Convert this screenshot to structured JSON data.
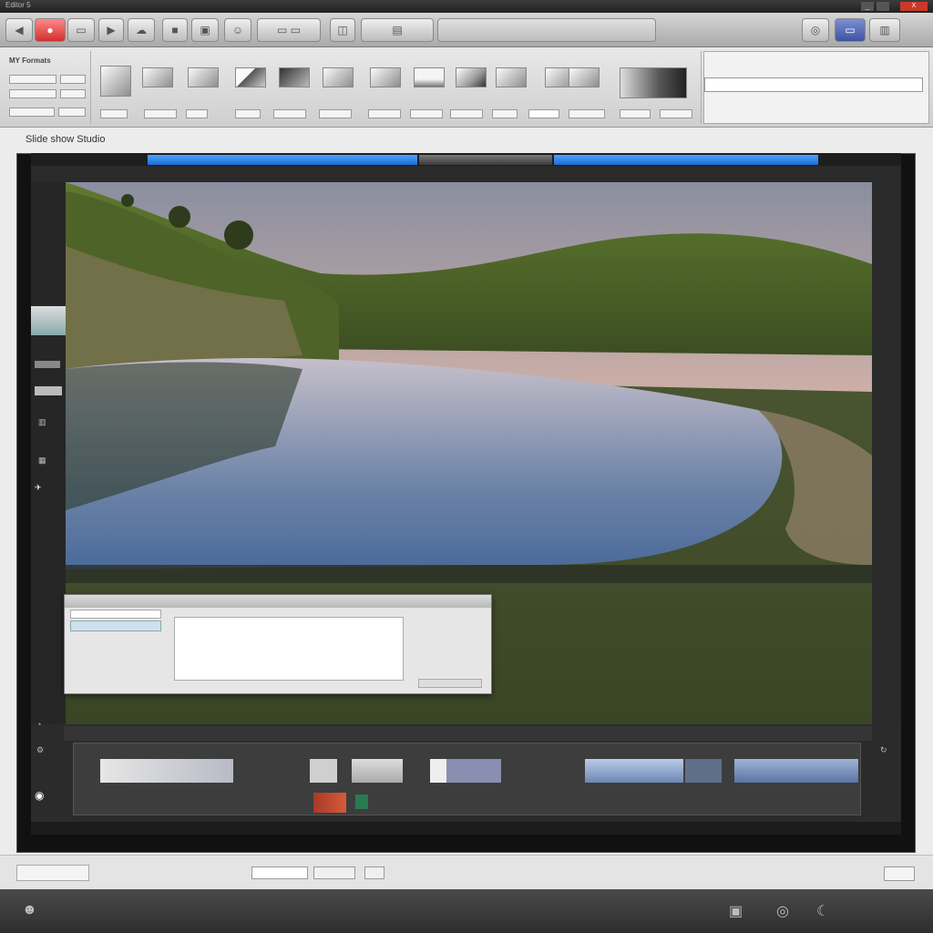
{
  "window": {
    "title": "Editor 5",
    "center_title": "",
    "minimize": "_",
    "close_label": "X"
  },
  "toolbar": {
    "items": [
      "nav-back",
      "nav-forward",
      "film",
      "play",
      "cloud",
      "square",
      "crop",
      "smile",
      "export",
      "window",
      "box",
      "capture"
    ]
  },
  "ribbon": {
    "group1_title": "MY Formats",
    "group1_rows": [
      "",
      "",
      ""
    ],
    "tools": [
      "",
      "",
      "",
      "",
      "",
      "",
      "",
      "",
      "",
      "",
      "",
      "",
      ""
    ],
    "panel_title": "",
    "panel_value": ""
  },
  "frame": {
    "title": "Slide show Studio"
  },
  "viewer": {
    "sub_left": "",
    "sub_right": ""
  },
  "dialog": {
    "title": "",
    "left_items": [
      "",
      "",
      ""
    ],
    "list_rows": [
      "",
      "",
      ""
    ],
    "bottom_text": "",
    "bottom_sub": "",
    "right_text": ""
  },
  "timeline": {
    "header": ""
  },
  "ruler": {
    "ticks": [
      "",
      "",
      "",
      "",
      "",
      "",
      "",
      "",
      "",
      "",
      "",
      "",
      "",
      ""
    ]
  },
  "bottom": {
    "left": "",
    "center": "",
    "right": ""
  },
  "colors": {
    "accent": "#1d6dd4",
    "close": "#c8392b"
  }
}
